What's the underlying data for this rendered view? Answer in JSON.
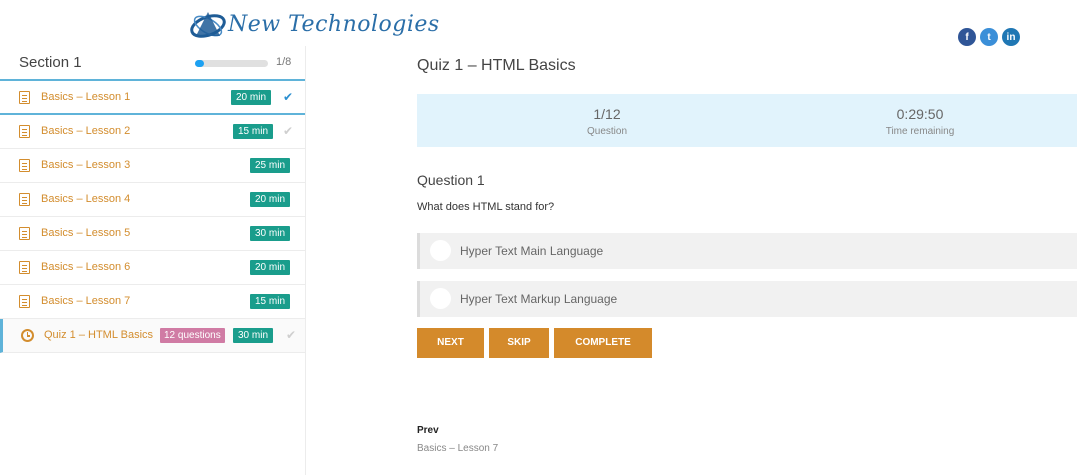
{
  "header": {
    "logo_text": "New Technologies",
    "social": [
      "f",
      "t",
      "in"
    ]
  },
  "sidebar": {
    "section_title": "Section 1",
    "progress_text": "1/8",
    "progress_value": 0.125,
    "items": [
      {
        "label": "Basics – Lesson 1",
        "time": "20 min",
        "completed": true
      },
      {
        "label": "Basics – Lesson 2",
        "time": "15 min",
        "completed": false
      },
      {
        "label": "Basics – Lesson 3",
        "time": "25 min"
      },
      {
        "label": "Basics – Lesson 4",
        "time": "20 min"
      },
      {
        "label": "Basics – Lesson 5",
        "time": "30 min"
      },
      {
        "label": "Basics – Lesson 6",
        "time": "20 min"
      },
      {
        "label": "Basics – Lesson 7",
        "time": "15 min"
      },
      {
        "label": "Quiz 1 – HTML Basics",
        "questions": "12 questions",
        "time": "30 min",
        "completed": false
      }
    ]
  },
  "main": {
    "quiz_title": "Quiz 1 – HTML Basics",
    "question_counter": "1/12",
    "question_counter_label": "Question",
    "time_remaining": "0:29:50",
    "time_remaining_label": "Time remaining",
    "question_heading": "Question 1",
    "question_text": "What does HTML stand for?",
    "options": [
      "Hyper Text Main Language",
      "Hyper Text Markup Language"
    ],
    "buttons": {
      "next": "NEXT",
      "skip": "SKIP",
      "complete": "COMPLETE"
    },
    "prev_label": "Prev",
    "prev_link": "Basics – Lesson 7"
  },
  "colors": {
    "accent_orange": "#d48a2b",
    "badge_green": "#1a9d8c",
    "badge_pink": "#d07ba4",
    "info_blue": "#e1f3fc",
    "active_blue": "#5fb3d9"
  }
}
